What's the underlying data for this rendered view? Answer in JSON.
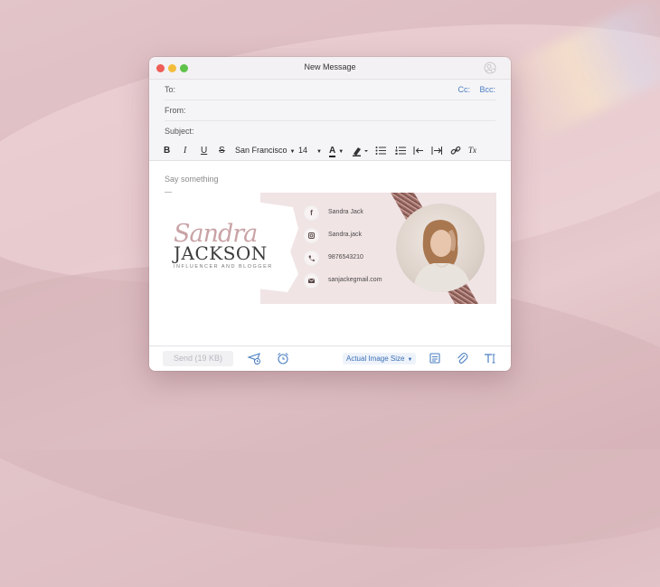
{
  "window": {
    "title": "New Message"
  },
  "fields": {
    "to_label": "To:",
    "from_label": "From:",
    "subject_label": "Subject:",
    "cc_label": "Cc:",
    "bcc_label": "Bcc:"
  },
  "toolbar": {
    "bold": "B",
    "italic": "I",
    "underline": "U",
    "strike": "S",
    "font": "San Francisco",
    "font_size": "14",
    "text_color_glyph": "A",
    "clear_format_glyph": "Tx"
  },
  "body": {
    "placeholder": "Say something"
  },
  "signature": {
    "script_name": "Sandra",
    "surname": "JACKSON",
    "subtitle": "INFLUENCER AND BLOGGER",
    "contacts": [
      {
        "icon": "facebook-icon",
        "text": "Sandra Jack"
      },
      {
        "icon": "instagram-icon",
        "text": "Sandra.jack"
      },
      {
        "icon": "phone-icon",
        "text": "9876543210"
      },
      {
        "icon": "mail-icon",
        "text": "sanjackegmail.com"
      }
    ],
    "accent_color": "#f1e4e5"
  },
  "footer": {
    "send_label": "Send (19 KB)",
    "image_size_label": "Actual Image Size"
  },
  "colors": {
    "link_blue": "#4a7fc1",
    "close": "#ee5e56",
    "minimize": "#f3bd3c",
    "zoom": "#5fc249"
  }
}
